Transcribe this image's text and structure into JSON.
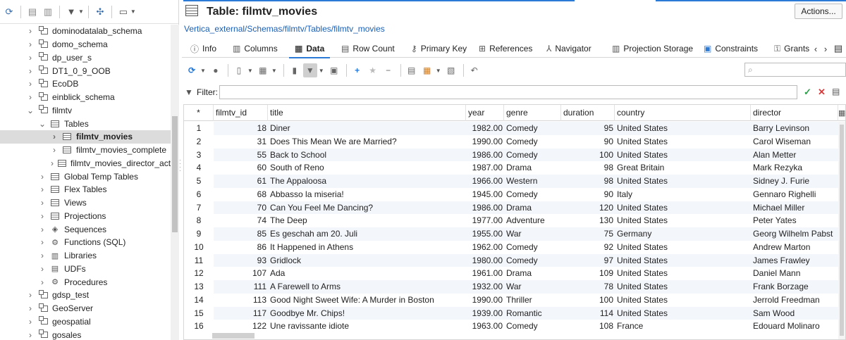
{
  "colors": {
    "accent": "#2b7bd6",
    "selected_row": "#dcdcdc",
    "link": "#1a5fb4",
    "alt_row": "#f3f6fb"
  },
  "left_toolbar": {
    "icons": [
      "refresh-icon",
      "new-connection-icon",
      "new-folder-icon",
      "filter-icon",
      "collapse-icon",
      "view-icon"
    ]
  },
  "tree": {
    "items": [
      {
        "label": "dominodatalab_schema",
        "level": 0,
        "expanded": false,
        "icon": "schema-icon"
      },
      {
        "label": "domo_schema",
        "level": 0,
        "expanded": false,
        "icon": "schema-icon"
      },
      {
        "label": "dp_user_s",
        "level": 0,
        "expanded": false,
        "icon": "schema-icon"
      },
      {
        "label": "DT1_0_9_OOB",
        "level": 0,
        "expanded": false,
        "icon": "schema-icon"
      },
      {
        "label": "EcoDB",
        "level": 0,
        "expanded": false,
        "icon": "schema-icon"
      },
      {
        "label": "einblick_schema",
        "level": 0,
        "expanded": false,
        "icon": "schema-icon"
      },
      {
        "label": "filmtv",
        "level": 0,
        "expanded": true,
        "icon": "schema-icon"
      },
      {
        "label": "Tables",
        "level": 1,
        "expanded": true,
        "icon": "table-icon"
      },
      {
        "label": "filmtv_movies",
        "level": 2,
        "expanded": false,
        "icon": "table-icon",
        "selected": true
      },
      {
        "label": "filmtv_movies_complete",
        "level": 2,
        "expanded": false,
        "icon": "table-icon"
      },
      {
        "label": "filmtv_movies_director_acto",
        "level": 2,
        "expanded": false,
        "icon": "table-icon"
      },
      {
        "label": "Global Temp Tables",
        "level": 1,
        "expanded": false,
        "icon": "table-icon"
      },
      {
        "label": "Flex Tables",
        "level": 1,
        "expanded": false,
        "icon": "table-icon"
      },
      {
        "label": "Views",
        "level": 1,
        "expanded": false,
        "icon": "table-icon"
      },
      {
        "label": "Projections",
        "level": 1,
        "expanded": false,
        "icon": "table-icon"
      },
      {
        "label": "Sequences",
        "level": 1,
        "expanded": false,
        "icon": "sequence-icon"
      },
      {
        "label": "Functions (SQL)",
        "level": 1,
        "expanded": false,
        "icon": "function-icon"
      },
      {
        "label": "Libraries",
        "level": 1,
        "expanded": false,
        "icon": "library-icon"
      },
      {
        "label": "UDFs",
        "level": 1,
        "expanded": false,
        "icon": "udf-icon"
      },
      {
        "label": "Procedures",
        "level": 1,
        "expanded": false,
        "icon": "procedure-icon"
      },
      {
        "label": "gdsp_test",
        "level": 0,
        "expanded": false,
        "icon": "schema-icon"
      },
      {
        "label": "GeoServer",
        "level": 0,
        "expanded": false,
        "icon": "schema-icon"
      },
      {
        "label": "geospatial",
        "level": 0,
        "expanded": false,
        "icon": "schema-icon"
      },
      {
        "label": "gosales",
        "level": 0,
        "expanded": false,
        "icon": "schema-icon"
      }
    ]
  },
  "editor": {
    "title": "Table: filmtv_movies",
    "actions_label": "Actions...",
    "breadcrumb": "Vertica_external/Schemas/filmtv/Tables/filmtv_movies",
    "tabs": [
      {
        "label": "Info",
        "icon": "info-icon",
        "active": false
      },
      {
        "label": "Columns",
        "icon": "columns-icon",
        "active": false
      },
      {
        "label": "Data",
        "icon": "data-icon",
        "active": true
      },
      {
        "label": "Row Count",
        "icon": "row-count-icon",
        "active": false
      },
      {
        "label": "Primary Key",
        "icon": "key-icon",
        "active": false
      },
      {
        "label": "References",
        "icon": "references-icon",
        "active": false
      },
      {
        "label": "Navigator",
        "icon": "navigator-icon",
        "active": false
      },
      {
        "label": "Projection Storage",
        "icon": "storage-icon",
        "active": false
      },
      {
        "label": "Constraints",
        "icon": "constraints-icon",
        "active": false
      },
      {
        "label": "Grants",
        "icon": "grants-icon",
        "active": false
      }
    ],
    "search_placeholder": "",
    "filter_label": "Filter:",
    "filter_value": ""
  },
  "grid": {
    "columns": [
      {
        "label": "*"
      },
      {
        "label": "filmtv_id"
      },
      {
        "label": "title"
      },
      {
        "label": "year"
      },
      {
        "label": "genre"
      },
      {
        "label": "duration"
      },
      {
        "label": "country"
      },
      {
        "label": "director"
      }
    ],
    "rows": [
      [
        "1",
        "18",
        "Diner",
        "1982.00",
        "Comedy",
        "95",
        "United States",
        "Barry Levinson"
      ],
      [
        "2",
        "31",
        "Does This Mean We are Married?",
        "1990.00",
        "Comedy",
        "90",
        "United States",
        "Carol Wiseman"
      ],
      [
        "3",
        "55",
        "Back to School",
        "1986.00",
        "Comedy",
        "100",
        "United States",
        "Alan Metter"
      ],
      [
        "4",
        "60",
        "South of Reno",
        "1987.00",
        "Drama",
        "98",
        "Great Britain",
        "Mark Rezyka"
      ],
      [
        "5",
        "61",
        "The Appaloosa",
        "1966.00",
        "Western",
        "98",
        "United States",
        "Sidney J. Furie"
      ],
      [
        "6",
        "68",
        "Abbasso la miseria!",
        "1945.00",
        "Comedy",
        "90",
        "Italy",
        "Gennaro Righelli"
      ],
      [
        "7",
        "70",
        "Can You Feel Me Dancing?",
        "1986.00",
        "Drama",
        "120",
        "United States",
        "Michael Miller"
      ],
      [
        "8",
        "74",
        "The Deep",
        "1977.00",
        "Adventure",
        "130",
        "United States",
        "Peter Yates"
      ],
      [
        "9",
        "85",
        "Es geschah am 20. Juli",
        "1955.00",
        "War",
        "75",
        "Germany",
        "Georg Wilhelm Pabst"
      ],
      [
        "10",
        "86",
        "It Happened in Athens",
        "1962.00",
        "Comedy",
        "92",
        "United States",
        "Andrew Marton"
      ],
      [
        "11",
        "93",
        "Gridlock",
        "1980.00",
        "Comedy",
        "97",
        "United States",
        "James Frawley"
      ],
      [
        "12",
        "107",
        "Ada",
        "1961.00",
        "Drama",
        "109",
        "United States",
        "Daniel Mann"
      ],
      [
        "13",
        "111",
        "A Farewell to Arms",
        "1932.00",
        "War",
        "78",
        "United States",
        "Frank Borzage"
      ],
      [
        "14",
        "113",
        "Good Night Sweet Wife: A Murder in Boston",
        "1990.00",
        "Thriller",
        "100",
        "United States",
        "Jerrold Freedman"
      ],
      [
        "15",
        "117",
        "Goodbye Mr. Chips!",
        "1939.00",
        "Romantic",
        "114",
        "United States",
        "Sam Wood"
      ],
      [
        "16",
        "122",
        "Une ravissante idiote",
        "1963.00",
        "Comedy",
        "108",
        "France",
        "Edouard Molinaro"
      ]
    ]
  }
}
